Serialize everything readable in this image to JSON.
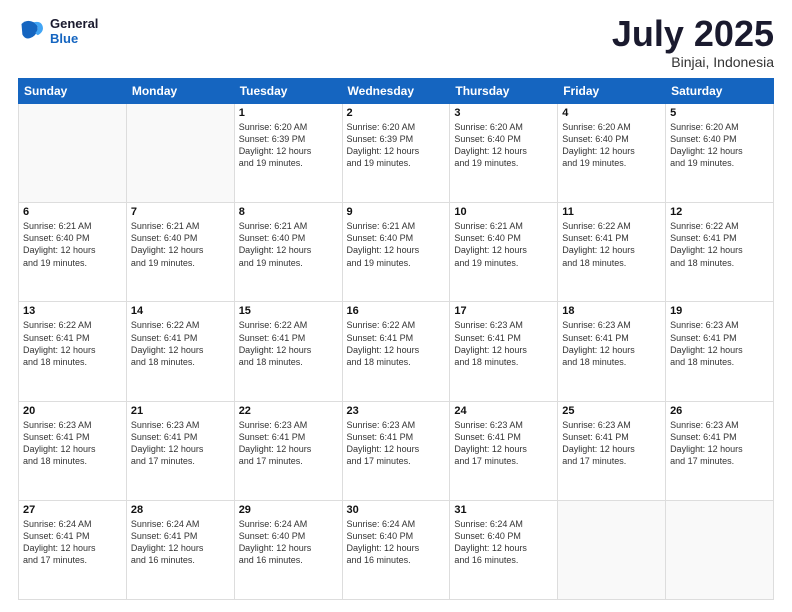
{
  "header": {
    "logo_line1": "General",
    "logo_line2": "Blue",
    "title": "July 2025",
    "subtitle": "Binjai, Indonesia"
  },
  "calendar": {
    "weekdays": [
      "Sunday",
      "Monday",
      "Tuesday",
      "Wednesday",
      "Thursday",
      "Friday",
      "Saturday"
    ],
    "weeks": [
      [
        {
          "day": "",
          "info": ""
        },
        {
          "day": "",
          "info": ""
        },
        {
          "day": "1",
          "info": "Sunrise: 6:20 AM\nSunset: 6:39 PM\nDaylight: 12 hours\nand 19 minutes."
        },
        {
          "day": "2",
          "info": "Sunrise: 6:20 AM\nSunset: 6:39 PM\nDaylight: 12 hours\nand 19 minutes."
        },
        {
          "day": "3",
          "info": "Sunrise: 6:20 AM\nSunset: 6:40 PM\nDaylight: 12 hours\nand 19 minutes."
        },
        {
          "day": "4",
          "info": "Sunrise: 6:20 AM\nSunset: 6:40 PM\nDaylight: 12 hours\nand 19 minutes."
        },
        {
          "day": "5",
          "info": "Sunrise: 6:20 AM\nSunset: 6:40 PM\nDaylight: 12 hours\nand 19 minutes."
        }
      ],
      [
        {
          "day": "6",
          "info": "Sunrise: 6:21 AM\nSunset: 6:40 PM\nDaylight: 12 hours\nand 19 minutes."
        },
        {
          "day": "7",
          "info": "Sunrise: 6:21 AM\nSunset: 6:40 PM\nDaylight: 12 hours\nand 19 minutes."
        },
        {
          "day": "8",
          "info": "Sunrise: 6:21 AM\nSunset: 6:40 PM\nDaylight: 12 hours\nand 19 minutes."
        },
        {
          "day": "9",
          "info": "Sunrise: 6:21 AM\nSunset: 6:40 PM\nDaylight: 12 hours\nand 19 minutes."
        },
        {
          "day": "10",
          "info": "Sunrise: 6:21 AM\nSunset: 6:40 PM\nDaylight: 12 hours\nand 19 minutes."
        },
        {
          "day": "11",
          "info": "Sunrise: 6:22 AM\nSunset: 6:41 PM\nDaylight: 12 hours\nand 18 minutes."
        },
        {
          "day": "12",
          "info": "Sunrise: 6:22 AM\nSunset: 6:41 PM\nDaylight: 12 hours\nand 18 minutes."
        }
      ],
      [
        {
          "day": "13",
          "info": "Sunrise: 6:22 AM\nSunset: 6:41 PM\nDaylight: 12 hours\nand 18 minutes."
        },
        {
          "day": "14",
          "info": "Sunrise: 6:22 AM\nSunset: 6:41 PM\nDaylight: 12 hours\nand 18 minutes."
        },
        {
          "day": "15",
          "info": "Sunrise: 6:22 AM\nSunset: 6:41 PM\nDaylight: 12 hours\nand 18 minutes."
        },
        {
          "day": "16",
          "info": "Sunrise: 6:22 AM\nSunset: 6:41 PM\nDaylight: 12 hours\nand 18 minutes."
        },
        {
          "day": "17",
          "info": "Sunrise: 6:23 AM\nSunset: 6:41 PM\nDaylight: 12 hours\nand 18 minutes."
        },
        {
          "day": "18",
          "info": "Sunrise: 6:23 AM\nSunset: 6:41 PM\nDaylight: 12 hours\nand 18 minutes."
        },
        {
          "day": "19",
          "info": "Sunrise: 6:23 AM\nSunset: 6:41 PM\nDaylight: 12 hours\nand 18 minutes."
        }
      ],
      [
        {
          "day": "20",
          "info": "Sunrise: 6:23 AM\nSunset: 6:41 PM\nDaylight: 12 hours\nand 18 minutes."
        },
        {
          "day": "21",
          "info": "Sunrise: 6:23 AM\nSunset: 6:41 PM\nDaylight: 12 hours\nand 17 minutes."
        },
        {
          "day": "22",
          "info": "Sunrise: 6:23 AM\nSunset: 6:41 PM\nDaylight: 12 hours\nand 17 minutes."
        },
        {
          "day": "23",
          "info": "Sunrise: 6:23 AM\nSunset: 6:41 PM\nDaylight: 12 hours\nand 17 minutes."
        },
        {
          "day": "24",
          "info": "Sunrise: 6:23 AM\nSunset: 6:41 PM\nDaylight: 12 hours\nand 17 minutes."
        },
        {
          "day": "25",
          "info": "Sunrise: 6:23 AM\nSunset: 6:41 PM\nDaylight: 12 hours\nand 17 minutes."
        },
        {
          "day": "26",
          "info": "Sunrise: 6:23 AM\nSunset: 6:41 PM\nDaylight: 12 hours\nand 17 minutes."
        }
      ],
      [
        {
          "day": "27",
          "info": "Sunrise: 6:24 AM\nSunset: 6:41 PM\nDaylight: 12 hours\nand 17 minutes."
        },
        {
          "day": "28",
          "info": "Sunrise: 6:24 AM\nSunset: 6:41 PM\nDaylight: 12 hours\nand 16 minutes."
        },
        {
          "day": "29",
          "info": "Sunrise: 6:24 AM\nSunset: 6:40 PM\nDaylight: 12 hours\nand 16 minutes."
        },
        {
          "day": "30",
          "info": "Sunrise: 6:24 AM\nSunset: 6:40 PM\nDaylight: 12 hours\nand 16 minutes."
        },
        {
          "day": "31",
          "info": "Sunrise: 6:24 AM\nSunset: 6:40 PM\nDaylight: 12 hours\nand 16 minutes."
        },
        {
          "day": "",
          "info": ""
        },
        {
          "day": "",
          "info": ""
        }
      ]
    ]
  }
}
